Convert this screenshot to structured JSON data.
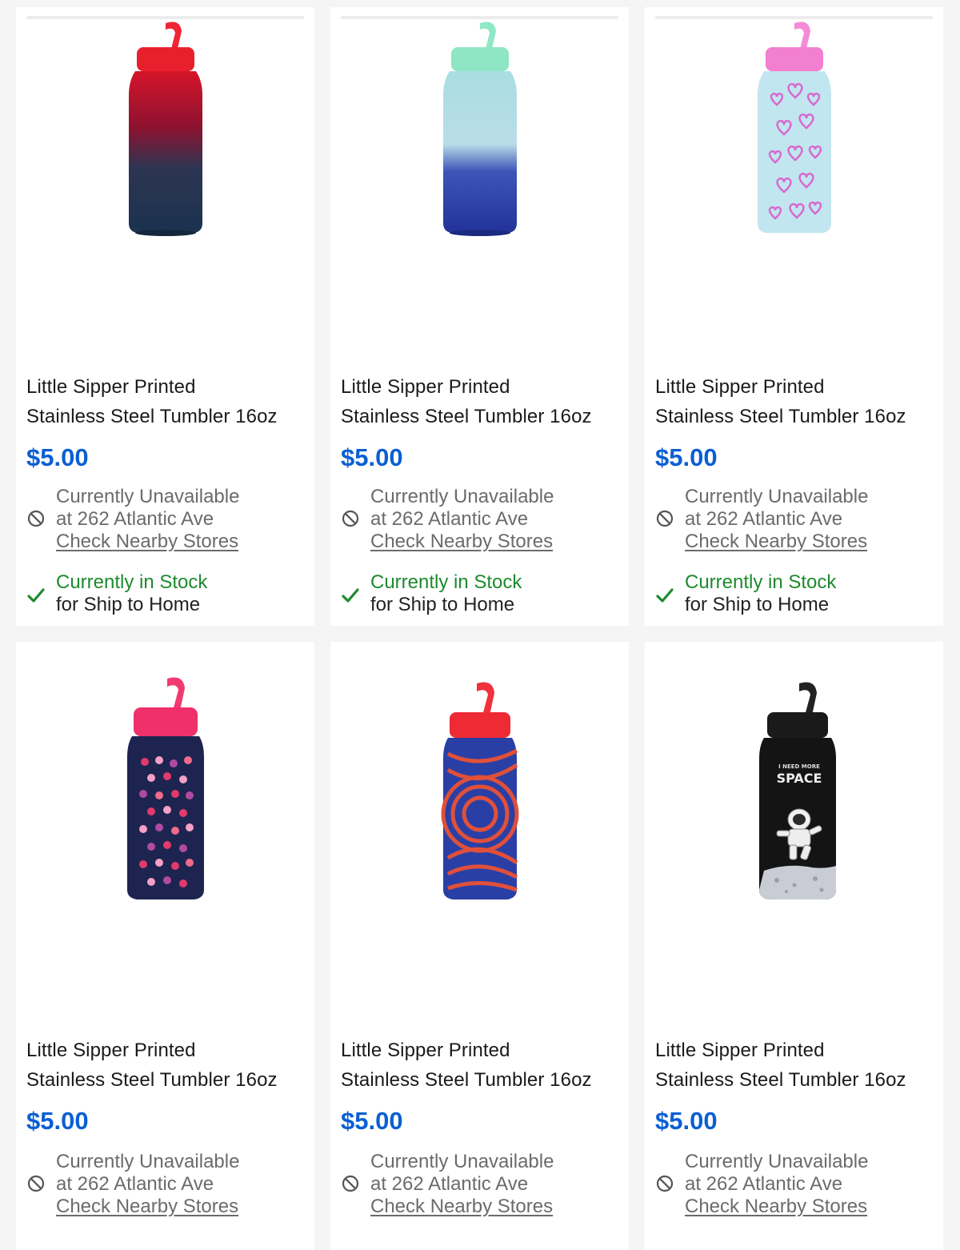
{
  "products": [
    {
      "title_line1": "Little Sipper Printed",
      "title_line2": "Stainless Steel Tumbler 16oz",
      "price": "$5.00",
      "store_status": "Currently Unavailable",
      "store_location": "at 262 Atlantic Ave",
      "store_link": "Check Nearby Stores",
      "ship_status": "Currently in Stock",
      "ship_sub": "for Ship to Home",
      "image_desc": "red-navy-gradient-bottle",
      "colors": {
        "lid": "#e8202e",
        "top": "#c0101e",
        "bottom": "#1d3a5f"
      }
    },
    {
      "title_line1": "Little Sipper Printed",
      "title_line2": "Stainless Steel Tumbler 16oz",
      "price": "$5.00",
      "store_status": "Currently Unavailable",
      "store_location": "at 262 Atlantic Ave",
      "store_link": "Check Nearby Stores",
      "ship_status": "Currently in Stock",
      "ship_sub": "for Ship to Home",
      "image_desc": "mint-blue-gradient-bottle",
      "colors": {
        "lid": "#8ee6c4",
        "top": "#b6e0e8",
        "bottom": "#223a9a"
      }
    },
    {
      "title_line1": "Little Sipper Printed",
      "title_line2": "Stainless Steel Tumbler 16oz",
      "price": "$5.00",
      "store_status": "Currently Unavailable",
      "store_location": "at 262 Atlantic Ave",
      "store_link": "Check Nearby Stores",
      "ship_status": "Currently in Stock",
      "ship_sub": "for Ship to Home",
      "image_desc": "pink-hearts-bottle",
      "colors": {
        "lid": "#f27fd0",
        "top": "#bfe5ee",
        "bottom": "#bfe5ee"
      }
    },
    {
      "title_line1": "Little Sipper Printed",
      "title_line2": "Stainless Steel Tumbler 16oz",
      "price": "$5.00",
      "store_status": "Currently Unavailable",
      "store_location": "at 262 Atlantic Ave",
      "store_link": "Check Nearby Stores",
      "ship_status": "",
      "ship_sub": "",
      "image_desc": "strawberry-hearts-bottle",
      "colors": {
        "lid": "#f0306a",
        "top": "#1d2450",
        "bottom": "#1d2450"
      }
    },
    {
      "title_line1": "Little Sipper Printed",
      "title_line2": "Stainless Steel Tumbler 16oz",
      "price": "$5.00",
      "store_status": "Currently Unavailable",
      "store_location": "at 262 Atlantic Ave",
      "store_link": "Check Nearby Stores",
      "ship_status": "",
      "ship_sub": "",
      "image_desc": "blue-orange-swirl-bottle",
      "colors": {
        "lid": "#ee2a35",
        "top": "#2a3fa5",
        "bottom": "#2a3fa5"
      }
    },
    {
      "title_line1": "Little Sipper Printed",
      "title_line2": "Stainless Steel Tumbler 16oz",
      "price": "$5.00",
      "store_status": "Currently Unavailable",
      "store_location": "at 262 Atlantic Ave",
      "store_link": "Check Nearby Stores",
      "ship_status": "",
      "ship_sub": "",
      "image_desc": "black-space-astronaut-bottle",
      "image_text_line1": "I NEED MORE",
      "image_text_line2": "SPACE",
      "colors": {
        "lid": "#1a1a1a",
        "top": "#141414",
        "bottom": "#141414"
      }
    }
  ],
  "colors": {
    "price": "#0a5fd3",
    "in_stock": "#1e8a2e",
    "muted": "#6b6b6b"
  },
  "icons": {
    "unavailable": "unavailable-icon",
    "check": "check-icon"
  }
}
